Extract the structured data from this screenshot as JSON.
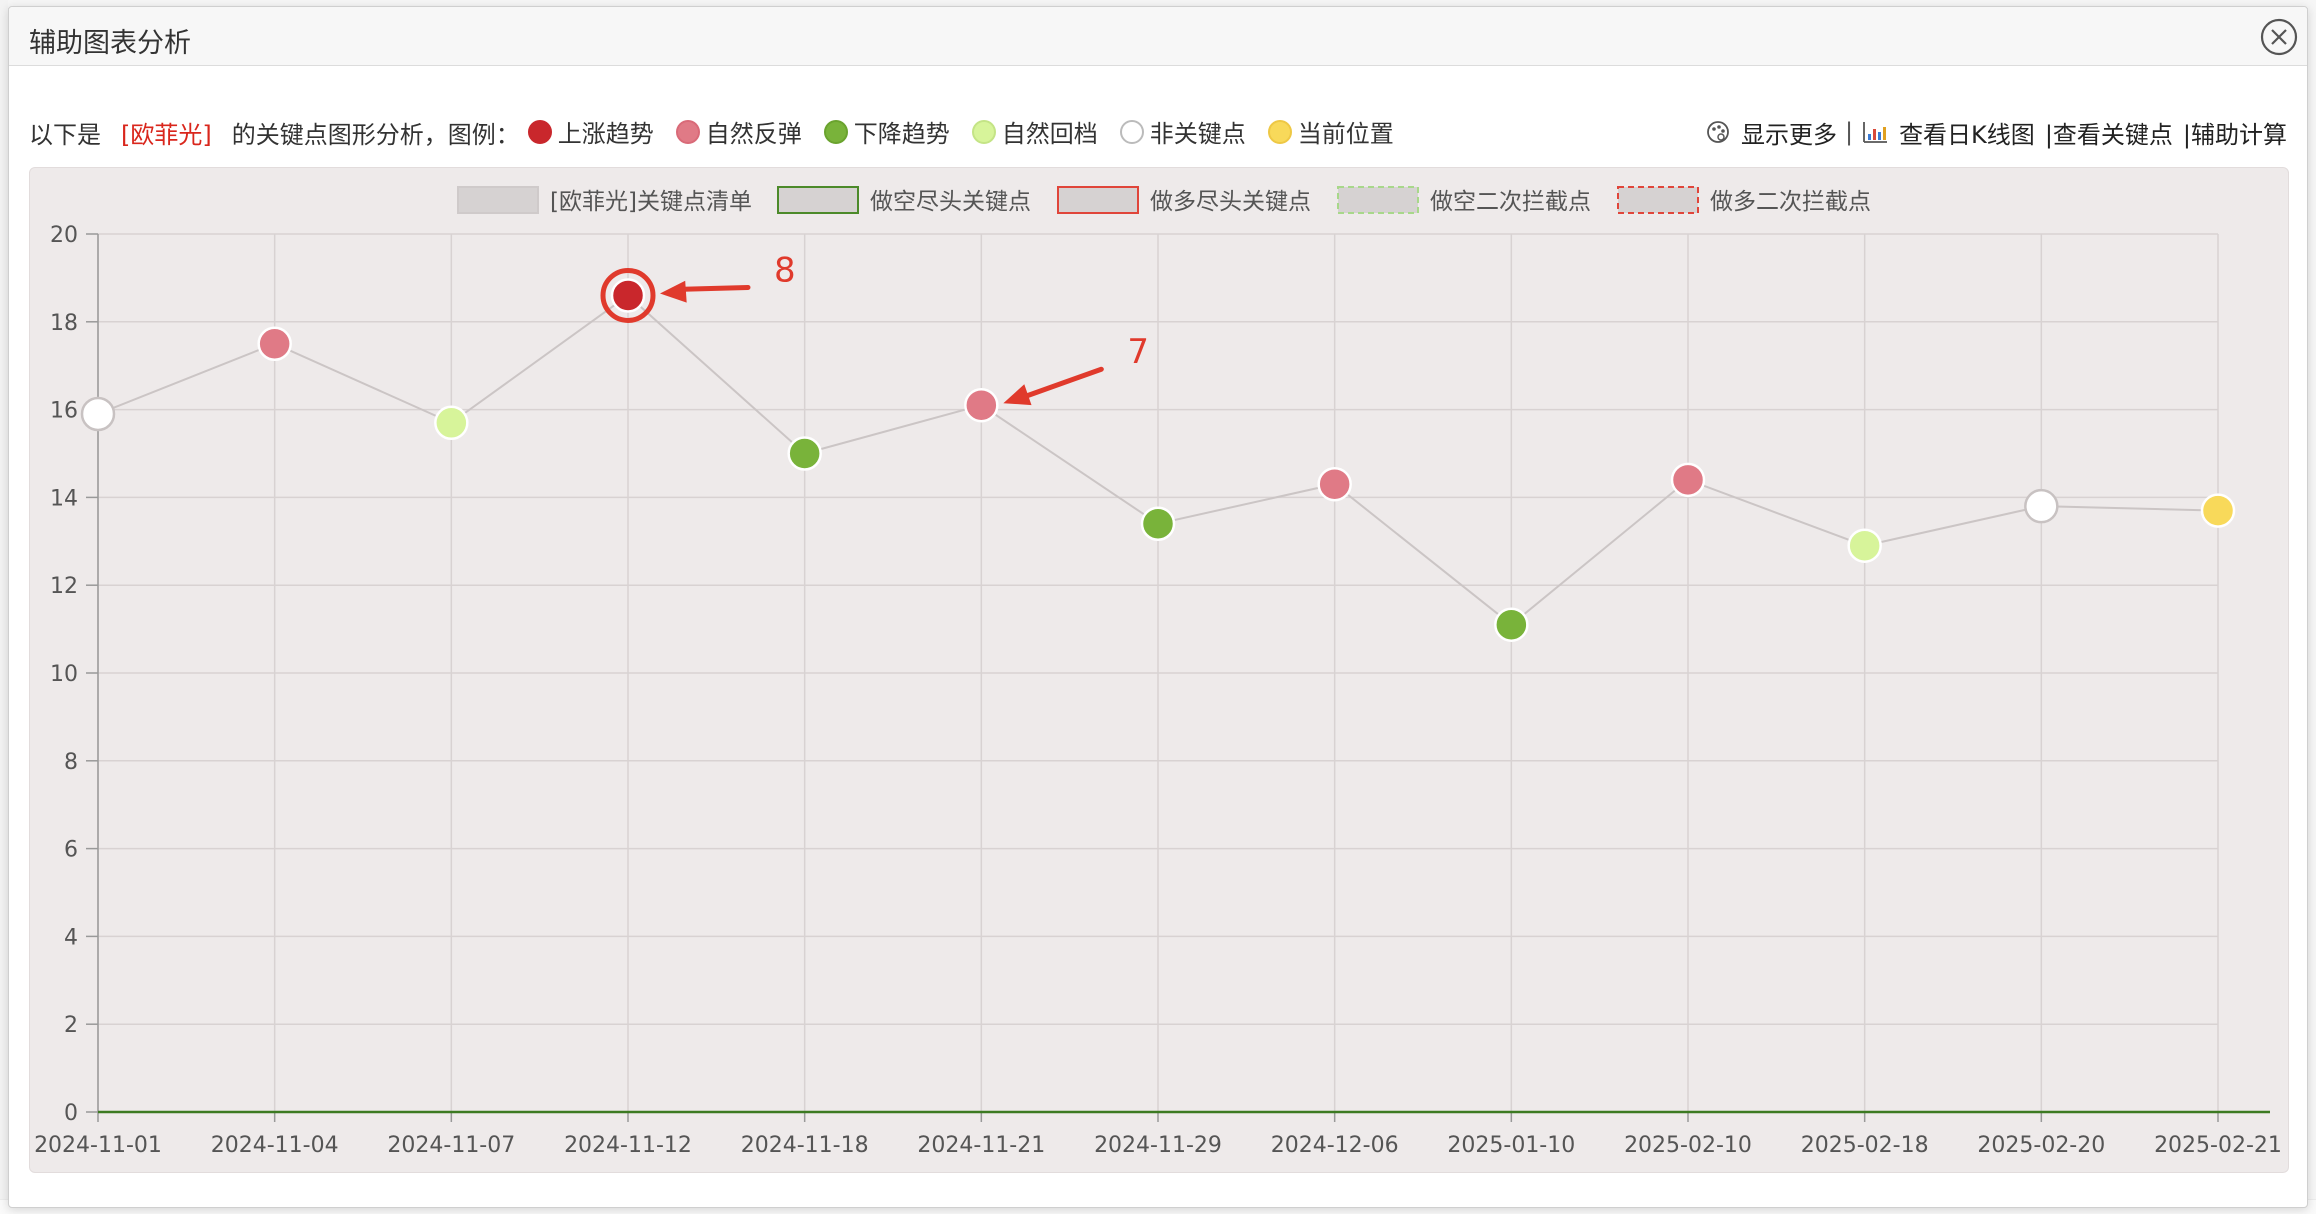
{
  "dialog": {
    "title": "辅助图表分析"
  },
  "infobar": {
    "prefix": "以下是",
    "stock": "[欧菲光]",
    "suffix": "的关键点图形分析，图例：",
    "legend": [
      {
        "label": "上涨趋势",
        "color": "#c9272c",
        "border": "#c9272c"
      },
      {
        "label": "自然反弹",
        "color": "#e07a86",
        "border": "#d96a78"
      },
      {
        "label": "下降趋势",
        "color": "#79b33a",
        "border": "#6aa32e"
      },
      {
        "label": "自然回档",
        "color": "#d7f49a",
        "border": "#c4e486"
      },
      {
        "label": "非关键点",
        "color": "#ffffff",
        "border": "#bbbbbb"
      },
      {
        "label": "当前位置",
        "color": "#f8d95a",
        "border": "#eec845"
      }
    ],
    "links": {
      "show_more": "显示更多",
      "sep1": "|",
      "kline": "查看日K线图",
      "view_keypoints": "|查看关键点",
      "calc": "|辅助计算"
    }
  },
  "chart_data": {
    "type": "line",
    "legend": [
      {
        "label": "[欧菲光]关键点清单",
        "style": "gray-fill"
      },
      {
        "label": "做空尽头关键点",
        "style": "green-border"
      },
      {
        "label": "做多尽头关键点",
        "style": "red-border"
      },
      {
        "label": "做空二次拦截点",
        "style": "green-dashed"
      },
      {
        "label": "做多二次拦截点",
        "style": "red-dashed"
      }
    ],
    "legend_placement": "top-center",
    "categories": [
      "2024-11-01",
      "2024-11-04",
      "2024-11-07",
      "2024-11-12",
      "2024-11-18",
      "2024-11-21",
      "2024-11-29",
      "2024-12-06",
      "2025-01-10",
      "2025-02-10",
      "2025-02-18",
      "2025-02-20",
      "2025-02-21"
    ],
    "values": [
      15.9,
      17.5,
      15.7,
      18.6,
      15.0,
      16.1,
      13.4,
      14.3,
      11.1,
      14.4,
      12.9,
      13.8,
      13.7
    ],
    "point_types": [
      "非关键点",
      "自然反弹",
      "自然回档",
      "上涨趋势",
      "下降趋势",
      "自然反弹",
      "下降趋势",
      "自然反弹",
      "下降趋势",
      "自然反弹",
      "自然回档",
      "非关键点",
      "当前位置"
    ],
    "ylim": [
      0,
      20
    ],
    "yticks": [
      "0",
      "2",
      "4",
      "6",
      "8",
      "10",
      "12",
      "14",
      "16",
      "18",
      "20"
    ],
    "grid": true,
    "annotations": [
      {
        "label": "8",
        "target_index": 3,
        "highlight": true
      },
      {
        "label": "7",
        "target_index": 5,
        "highlight": false
      }
    ]
  },
  "colors": {
    "line": "#cbc5c5",
    "grid": "#d8d2d2",
    "annotation": "#e03a2c",
    "baseline": "#3c7a22"
  }
}
